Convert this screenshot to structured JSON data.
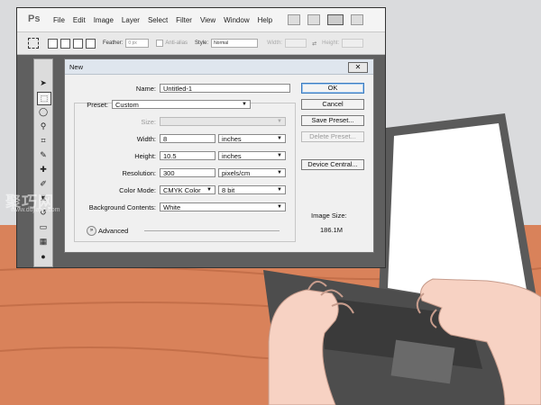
{
  "menubar": {
    "logo": "Ps",
    "items": [
      "File",
      "Edit",
      "Image",
      "Layer",
      "Select",
      "Filter",
      "View",
      "Window",
      "Help"
    ]
  },
  "options_bar": {
    "feather_label": "Feather:",
    "feather_value": "0 px",
    "anti_alias_label": "Anti-alias",
    "style_label": "Style:",
    "style_value": "Normal",
    "width_label": "Width:",
    "height_label": "Height:"
  },
  "dialog": {
    "title": "New",
    "close_glyph": "✕",
    "name": {
      "label": "Name:",
      "value": "Untitled-1"
    },
    "preset": {
      "label": "Preset:",
      "value": "Custom"
    },
    "size": {
      "label": "Size:"
    },
    "width": {
      "label": "Width:",
      "value": "8",
      "unit": "inches"
    },
    "height": {
      "label": "Height:",
      "value": "10.5",
      "unit": "inches"
    },
    "resolution": {
      "label": "Resolution:",
      "value": "300",
      "unit": "pixels/cm"
    },
    "color_mode": {
      "label": "Color Mode:",
      "value": "CMYK Color",
      "depth": "8 bit"
    },
    "background": {
      "label": "Background Contents:",
      "value": "White"
    },
    "advanced_label": "Advanced",
    "buttons": {
      "ok": "OK",
      "cancel": "Cancel",
      "save_preset": "Save Preset...",
      "delete_preset": "Delete Preset...",
      "device_central": "Device Central..."
    },
    "image_size": {
      "label": "Image Size:",
      "value": "186.1M"
    }
  },
  "watermark": {
    "text": "聚巧网",
    "url": "www.dujiaoa.com"
  },
  "colors": {
    "wall": "#dadbdd",
    "desk": "#d9825a",
    "laptop": "#5a5a5a",
    "skin": "#f7d2c3",
    "workspace": "#5f5f5f",
    "ok_border": "#3d7bbf"
  }
}
